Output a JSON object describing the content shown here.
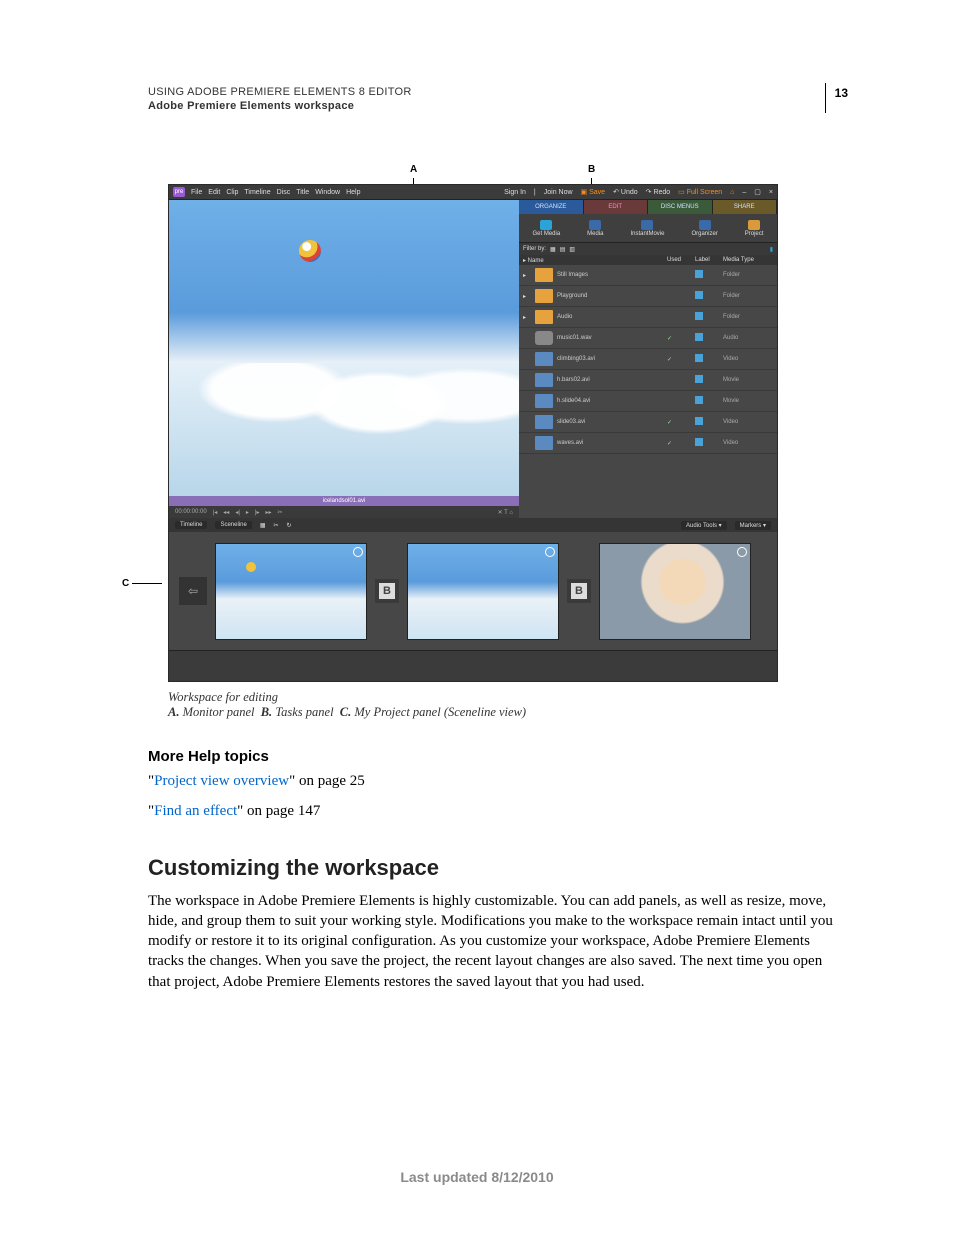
{
  "header": {
    "line1": "USING ADOBE PREMIERE ELEMENTS 8 EDITOR",
    "line2": "Adobe Premiere Elements workspace",
    "page_number": "13"
  },
  "callouts": {
    "A": "A",
    "B": "B",
    "C": "C"
  },
  "app": {
    "logo": "pre",
    "menus": [
      "File",
      "Edit",
      "Clip",
      "Timeline",
      "Disc",
      "Title",
      "Window",
      "Help"
    ],
    "right_actions": {
      "signin": "Sign In",
      "join": "Join Now",
      "save": "Save",
      "undo": "Undo",
      "redo": "Redo",
      "fullscreen": "Full Screen"
    },
    "window_icons": [
      "home-icon",
      "minimize-icon",
      "restore-icon",
      "close-icon"
    ],
    "tabs": {
      "organize": "ORGANIZE",
      "edit": "EDIT",
      "disc": "DISC MENUS",
      "share": "SHARE"
    },
    "tools": [
      {
        "label": "Get Media",
        "color": "#2aa3d8"
      },
      {
        "label": "Media",
        "color": "#3a6aa8"
      },
      {
        "label": "InstantMovie",
        "color": "#3a6aa8"
      },
      {
        "label": "Organizer",
        "color": "#3a6aa8"
      },
      {
        "label": "Project",
        "color": "#d89a3a"
      }
    ],
    "filter_label": "Filter by:",
    "columns": {
      "name": "▸ Name",
      "used": "Used",
      "label": "Label",
      "mediatype": "Media Type"
    },
    "rows": [
      {
        "kind": "folder",
        "name": "Still Images",
        "used": "",
        "type": "Folder"
      },
      {
        "kind": "folder",
        "name": "Playground",
        "used": "",
        "type": "Folder"
      },
      {
        "kind": "folder",
        "name": "Audio",
        "used": "",
        "type": "Folder"
      },
      {
        "kind": "audio",
        "name": "music01.wav",
        "used": "✓",
        "type": "Audio"
      },
      {
        "kind": "video",
        "name": "climbing03.avi",
        "used": "✓",
        "type": "Video"
      },
      {
        "kind": "video",
        "name": "h.bars02.avi",
        "used": "",
        "type": "Movie"
      },
      {
        "kind": "video",
        "name": "h.slide04.avi",
        "used": "",
        "type": "Movie"
      },
      {
        "kind": "video",
        "name": "slide03.avi",
        "used": "✓",
        "type": "Video"
      },
      {
        "kind": "video",
        "name": "waves.avi",
        "used": "✓",
        "type": "Video"
      }
    ],
    "clip_name": "icelandsol01.avi",
    "timecode": "00:00:00:00",
    "scenebar": {
      "timeline": "Timeline",
      "sceneline": "Sceneline",
      "audiotools": "Audio Tools ▾",
      "markers": "Markers ▾"
    },
    "trans_label": "B"
  },
  "caption": {
    "title": "Workspace for editing",
    "A": "A.",
    "A_text": "Monitor panel",
    "B": "B.",
    "B_text": "Tasks panel",
    "C": "C.",
    "C_text": "My Project panel (Sceneline view)"
  },
  "help": {
    "heading": "More Help topics",
    "q": "\"",
    "link1": "Project view overview",
    "after1": "\" on page 25",
    "link2": "Find an effect",
    "after2": "\" on page 147"
  },
  "section": {
    "heading": "Customizing the workspace",
    "para": "The workspace in Adobe Premiere Elements is highly customizable. You can add panels, as well as resize, move, hide, and group them to suit your working style. Modifications you make to the workspace remain intact until you modify or restore it to its original configuration. As you customize your workspace, Adobe Premiere Elements tracks the changes. When you save the project, the recent layout changes are also saved. The next time you open that project, Adobe Premiere Elements restores the saved layout that you had used."
  },
  "footer": "Last updated 8/12/2010"
}
